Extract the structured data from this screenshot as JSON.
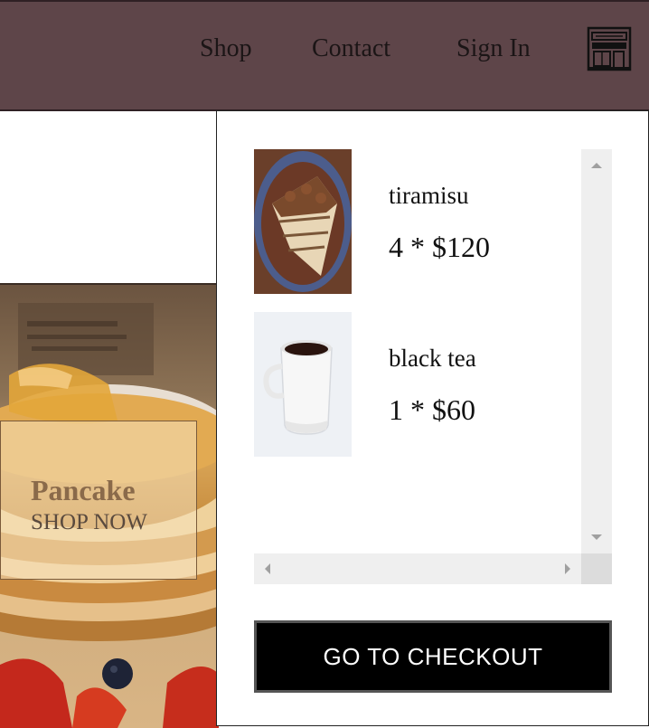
{
  "nav": {
    "links": [
      "Shop",
      "Contact",
      "Sign In"
    ],
    "store_icon": "storefront-icon",
    "background": "#5e4549"
  },
  "promo": {
    "title": "Pancake",
    "cta": "SHOP NOW"
  },
  "cart": {
    "items": [
      {
        "name": "tiramisu",
        "qty_price": "4 * $120",
        "thumbnail": "tiramisu-photo"
      },
      {
        "name": "black tea",
        "qty_price": "1 * $60",
        "thumbnail": "black-tea-photo"
      }
    ],
    "checkout_label": "GO TO CHECKOUT"
  }
}
